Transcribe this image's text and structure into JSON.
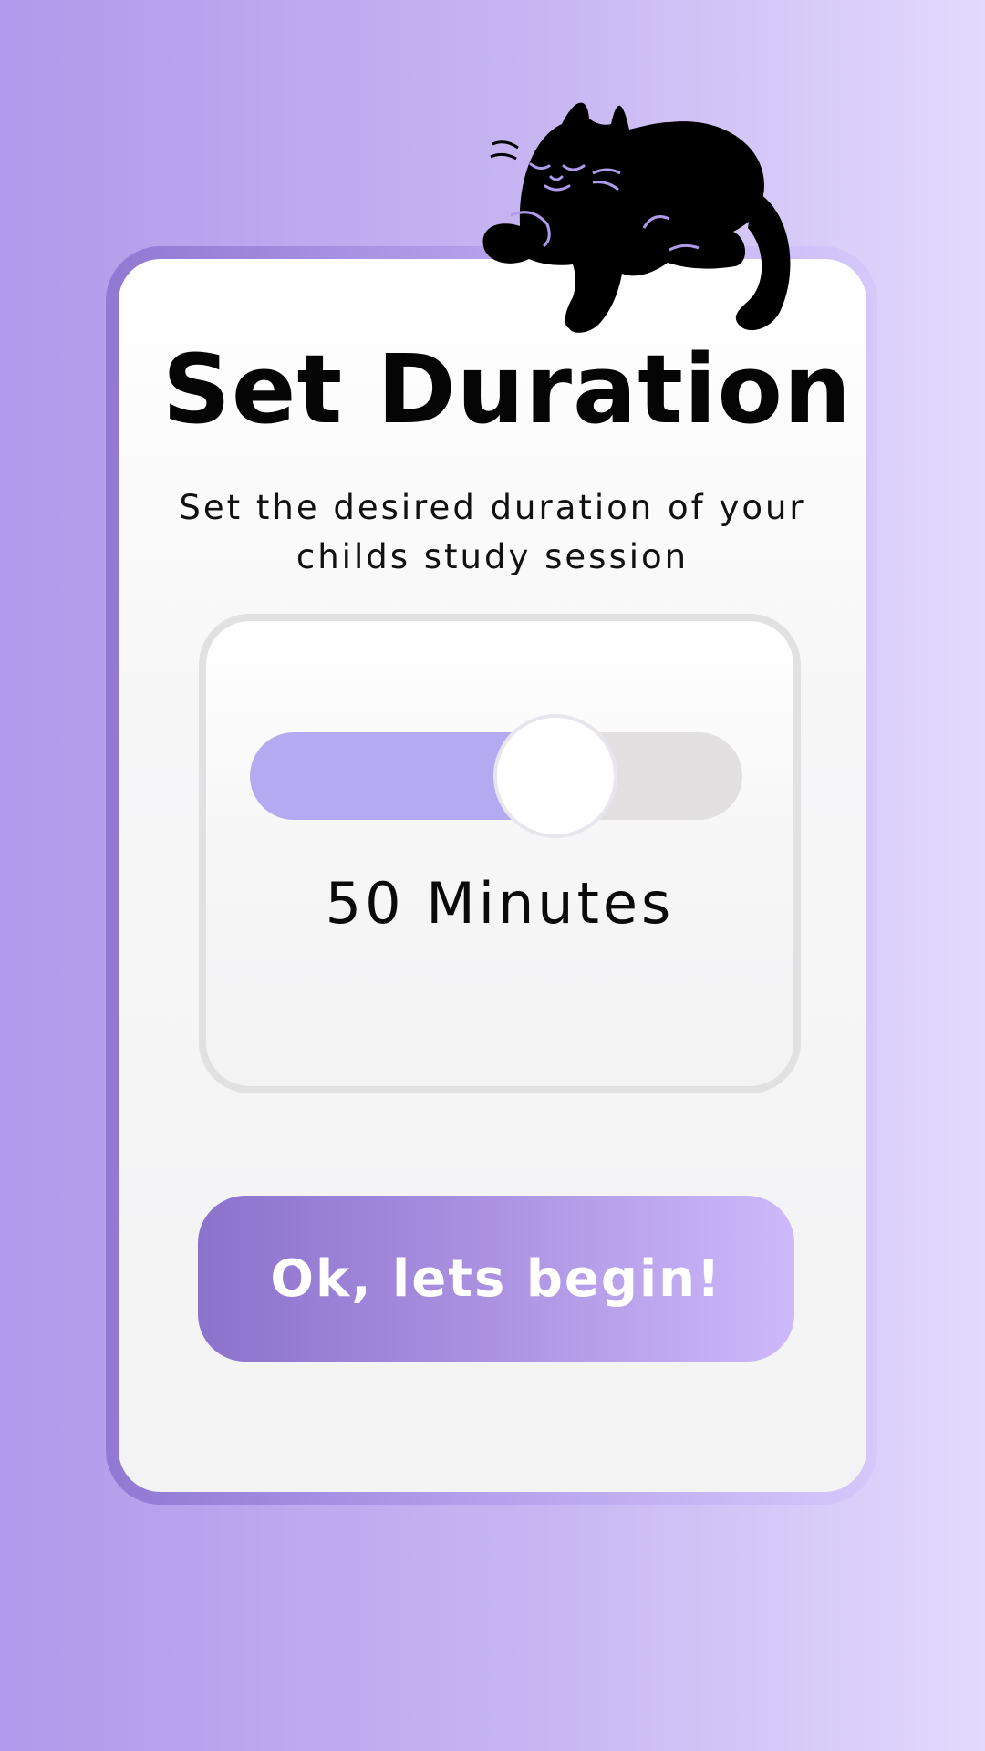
{
  "header": {
    "title": "Set Duration",
    "subtitle": "Set the desired duration of your childs study session"
  },
  "duration_slider": {
    "value_label": "50 Minutes",
    "value_fraction": 0.62,
    "colors": {
      "fill": "#b3aaf2",
      "track": "#e2e0e1",
      "thumb": "#ffffff"
    }
  },
  "actions": {
    "begin_label": "Ok, lets begin!"
  },
  "decor": {
    "mascot_icon": "sleeping-cat-icon"
  },
  "colors": {
    "accent_start": "#8b72cc",
    "accent_end": "#cdb9fb",
    "background_start": "#b09aeb",
    "background_end": "#e3d9fd"
  }
}
